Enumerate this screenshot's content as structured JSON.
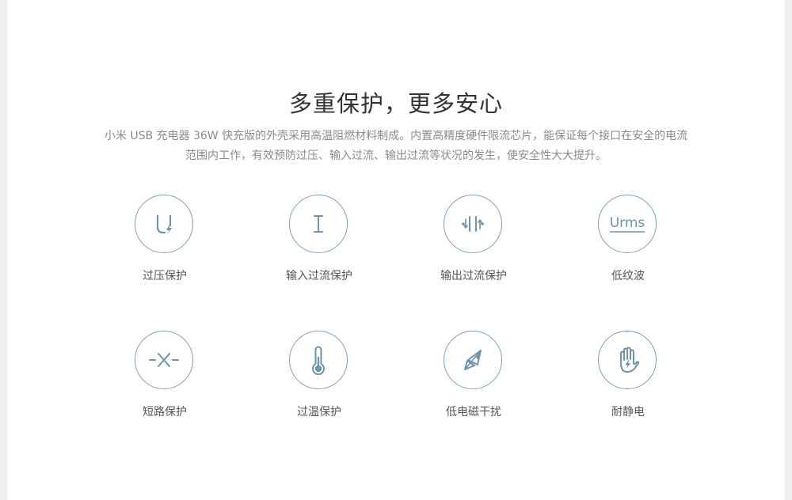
{
  "title": "多重保护，更多安心",
  "description": {
    "line1": "小米 USB 充电器 36W 快充版的外壳采用高温阻燃材料制成。内置高精度硬件限流芯片，能保证每个接口在安全的电流",
    "line2": "范围内工作，有效预防过压、输入过流、输出过流等状况的发生，使安全性大大提升。"
  },
  "features": [
    {
      "label": "过压保护",
      "icon": "overvoltage-icon"
    },
    {
      "label": "输入过流保护",
      "icon": "input-overcurrent-icon"
    },
    {
      "label": "输出过流保护",
      "icon": "output-overcurrent-icon"
    },
    {
      "label": "低纹波",
      "icon": "low-ripple-icon",
      "icon_text": "Urms"
    },
    {
      "label": "短路保护",
      "icon": "short-circuit-icon"
    },
    {
      "label": "过温保护",
      "icon": "thermometer-icon"
    },
    {
      "label": "低电磁干扰",
      "icon": "compass-icon"
    },
    {
      "label": "耐静电",
      "icon": "antistatic-hand-icon"
    }
  ],
  "colors": {
    "icon_stroke": "#7fa0b5",
    "icon_fill": "#6f93ab",
    "title": "#333333",
    "description": "#8a8a8a",
    "label": "#555555",
    "background": "#efefef",
    "panel": "#ffffff"
  }
}
